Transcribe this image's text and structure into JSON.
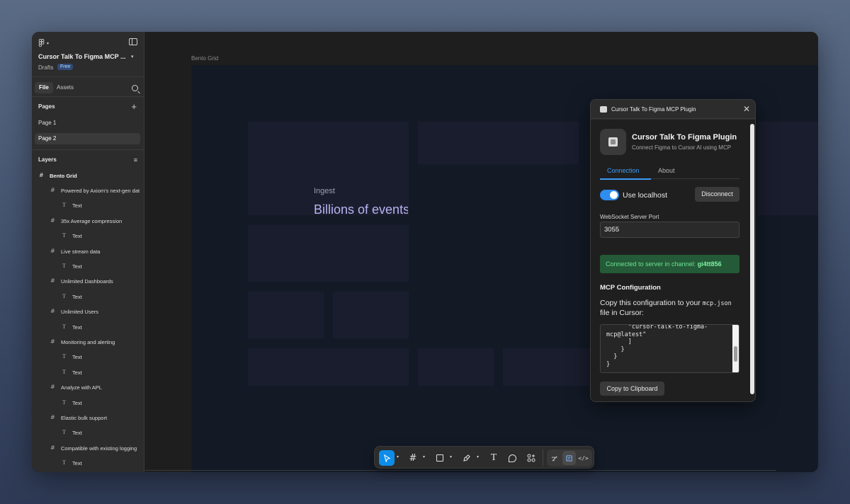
{
  "file": {
    "title": "Cursor Talk To Figma MCP ...",
    "drafts_label": "Drafts",
    "plan_badge": "Free"
  },
  "sidebar_tabs": {
    "file": "File",
    "assets": "Assets"
  },
  "pages": {
    "heading": "Pages",
    "items": [
      "Page 1",
      "Page 2"
    ],
    "active": "Page 2"
  },
  "layers": {
    "heading": "Layers",
    "root": "Bento Grid",
    "items": [
      {
        "label": "Powered by Axiom's next-gen dat",
        "icon": "frame-icon"
      },
      {
        "label": "Text",
        "icon": "text-icon"
      },
      {
        "label": "35x Average compression",
        "icon": "frame-icon"
      },
      {
        "label": "Text",
        "icon": "text-icon"
      },
      {
        "label": "Live stream data",
        "icon": "frame-icon"
      },
      {
        "label": "Text",
        "icon": "text-icon"
      },
      {
        "label": "Unlimited Dashboards",
        "icon": "frame-icon"
      },
      {
        "label": "Text",
        "icon": "text-icon"
      },
      {
        "label": "Unlimited Users",
        "icon": "frame-icon"
      },
      {
        "label": "Text",
        "icon": "text-icon"
      },
      {
        "label": "Monitoring and alerting",
        "icon": "frame-icon"
      },
      {
        "label": "Text",
        "icon": "text-icon"
      },
      {
        "label": "Text",
        "icon": "text-icon"
      },
      {
        "label": "Analyze with APL",
        "icon": "frame-icon"
      },
      {
        "label": "Text",
        "icon": "text-icon"
      },
      {
        "label": "Elastic bulk support",
        "icon": "frame-icon"
      },
      {
        "label": "Text",
        "icon": "text-icon"
      },
      {
        "label": "Compatible with existing logging",
        "icon": "frame-icon"
      },
      {
        "label": "Text",
        "icon": "text-icon"
      }
    ]
  },
  "canvas": {
    "frame_label": "Bento Grid",
    "ingest_label": "Ingest",
    "headline": "Billions of events"
  },
  "plugin": {
    "window_title": "Cursor Talk To Figma MCP Plugin",
    "name": "Cursor Talk To Figma Plugin",
    "description": "Connect Figma to Cursor AI using MCP",
    "tabs": [
      "Connection",
      "About"
    ],
    "active_tab": "Connection",
    "use_localhost_label": "Use localhost",
    "use_localhost_on": true,
    "disconnect_label": "Disconnect",
    "port_label": "WebSocket Server Port",
    "port_value": "3055",
    "status_prefix": "Connected to server in channel:",
    "channel": "gi4tt856",
    "mcp_heading": "MCP Configuration",
    "mcp_desc_before": "Copy this configuration to your",
    "mcp_desc_file": "mcp.json",
    "mcp_desc_after": "file in Cursor:",
    "config_snippet": "      \"cursor-talk-to-figma-\nmcp@latest\"\n      ]\n    }\n  }\n}",
    "copy_label": "Copy to Clipboard"
  },
  "toolbar": {
    "tools": [
      "move-tool",
      "frame-tool",
      "rectangle-tool",
      "pen-tool",
      "text-tool",
      "comment-tool",
      "actions-tool"
    ],
    "active_tool": "move-tool",
    "modes": [
      "draw-mode",
      "design-mode",
      "dev-mode"
    ],
    "active_mode": "design-mode"
  },
  "colors": {
    "accent": "#0d8ce9",
    "tab_active": "#3d9bf5",
    "status_bg": "#245a37",
    "status_text": "#6ee292",
    "headline": "#b9b3f0"
  }
}
